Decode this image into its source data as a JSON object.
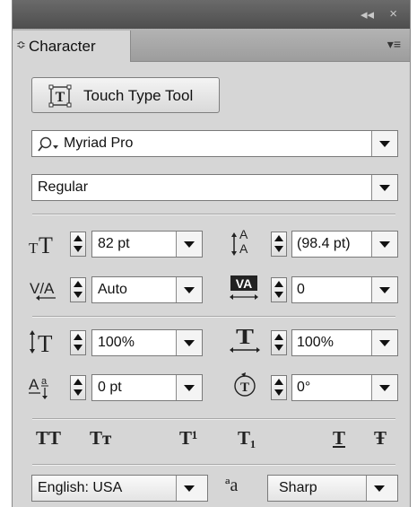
{
  "window": {
    "controls": [
      "collapse-icon",
      "close-icon"
    ],
    "collapse_glyph": "◂◂",
    "close_glyph": "×"
  },
  "tab": {
    "arrow_glyph": "≎",
    "label": "Character",
    "menu_icon": "panel-menu-icon",
    "menu_glyph": "▾≡"
  },
  "touch_type": {
    "label": "Touch Type Tool",
    "icon": "touch-type-icon"
  },
  "font_family": {
    "value": "Myriad Pro",
    "icon": "search-icon"
  },
  "font_style": {
    "value": "Regular"
  },
  "size": {
    "value": "82 pt",
    "icon": "font-size-icon"
  },
  "leading": {
    "value": "(98.4 pt)",
    "icon": "leading-icon"
  },
  "kerning": {
    "value": "Auto",
    "icon": "kerning-icon"
  },
  "tracking": {
    "value": "0",
    "icon": "tracking-icon"
  },
  "vertical_scale": {
    "value": "100%",
    "icon": "vertical-scale-icon"
  },
  "horizontal_scale": {
    "value": "100%",
    "icon": "horizontal-scale-icon"
  },
  "baseline_shift": {
    "value": "0 pt",
    "icon": "baseline-shift-icon"
  },
  "rotation": {
    "value": "0°",
    "icon": "rotation-icon"
  },
  "text_styles": [
    {
      "name": "all-caps-button",
      "glyph": "TT"
    },
    {
      "name": "small-caps-button",
      "glyph": "Tт"
    },
    {
      "name": "superscript-button",
      "glyph": "T¹"
    },
    {
      "name": "subscript-button",
      "glyph": "T₁"
    },
    {
      "name": "underline-button",
      "glyph": "T"
    },
    {
      "name": "strikethrough-button",
      "glyph": "Ŧ"
    }
  ],
  "language": {
    "value": "English: USA"
  },
  "antialias": {
    "value": "Sharp",
    "icon": "antialias-icon",
    "glyph": "ªa"
  }
}
